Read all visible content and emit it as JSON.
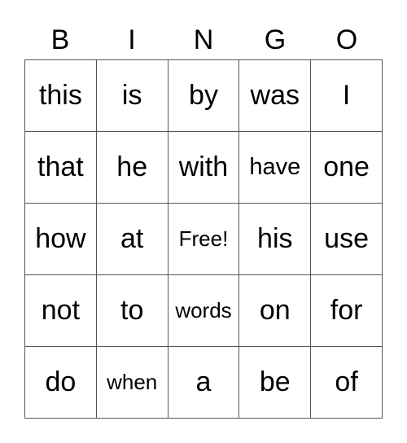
{
  "header": [
    "B",
    "I",
    "N",
    "G",
    "O"
  ],
  "rows": [
    [
      "this",
      "is",
      "by",
      "was",
      "I"
    ],
    [
      "that",
      "he",
      "with",
      "have",
      "one"
    ],
    [
      "how",
      "at",
      "Free!",
      "his",
      "use"
    ],
    [
      "not",
      "to",
      "words",
      "on",
      "for"
    ],
    [
      "do",
      "when",
      "a",
      "be",
      "of"
    ]
  ]
}
